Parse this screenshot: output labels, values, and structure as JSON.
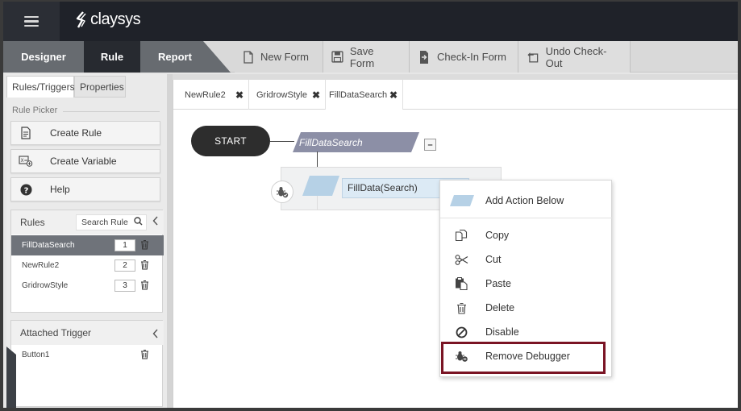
{
  "app": {
    "logo_text": "claysys"
  },
  "nav": {
    "tabs": [
      {
        "label": "Designer"
      },
      {
        "label": "Rule"
      },
      {
        "label": "Report"
      }
    ],
    "toolbar": [
      {
        "label": "New Form",
        "icon": "document-icon"
      },
      {
        "label": "Save Form",
        "icon": "floppy-disk-icon"
      },
      {
        "label": "Check-In Form",
        "icon": "check-in-icon"
      },
      {
        "label": "Undo Check-Out",
        "icon": "undo-icon"
      }
    ]
  },
  "leftpanel": {
    "subtabs": [
      {
        "label": "Rules/Triggers"
      },
      {
        "label": "Properties"
      }
    ],
    "section_title": "Rule Picker",
    "picker_buttons": [
      {
        "label": "Create Rule",
        "icon": "create-rule-icon"
      },
      {
        "label": "Create Variable",
        "icon": "create-variable-icon"
      },
      {
        "label": "Help",
        "icon": "help-icon"
      }
    ],
    "rules": {
      "title": "Rules",
      "search_placeholder": "Search Rule",
      "items": [
        {
          "name": "FillDataSearch",
          "order": "1",
          "selected": true
        },
        {
          "name": "NewRule2",
          "order": "2",
          "selected": false
        },
        {
          "name": "GridrowStyle",
          "order": "3",
          "selected": false
        }
      ]
    },
    "triggers": {
      "title": "Attached Trigger",
      "items": [
        {
          "name": "Button1"
        }
      ]
    }
  },
  "canvas": {
    "doctabs": [
      {
        "label": "NewRule2"
      },
      {
        "label": "GridrowStyle"
      },
      {
        "label": "FillDataSearch"
      }
    ],
    "start_label": "START",
    "rule_label": "FillDataSearch",
    "collapse_symbol": "–",
    "action_label": "FillData(Search)"
  },
  "context_menu": {
    "items": [
      {
        "label": "Add Action Below",
        "icon": "add-action-icon"
      },
      {
        "label": "Copy",
        "icon": "copy-icon"
      },
      {
        "label": "Cut",
        "icon": "scissors-icon"
      },
      {
        "label": "Paste",
        "icon": "paste-icon"
      },
      {
        "label": "Delete",
        "icon": "trash-icon"
      },
      {
        "label": "Disable",
        "icon": "disable-icon"
      },
      {
        "label": "Remove Debugger",
        "icon": "debugger-icon"
      }
    ],
    "highlighted": "Remove Debugger"
  },
  "colors": {
    "topbar": "#1f2229",
    "active_nav": "#272a30",
    "inactive_nav": "#676b70",
    "rule_shape": "#8c8fa6",
    "action_shape": "#b6d1e6",
    "highlight_border": "#7a1424"
  }
}
